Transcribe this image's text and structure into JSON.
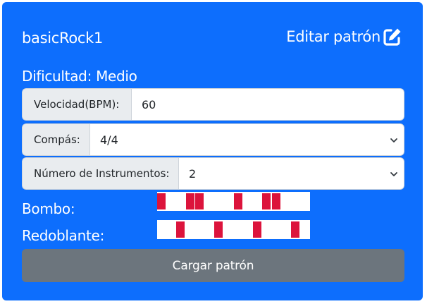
{
  "card": {
    "title": "basicRock1",
    "edit_label": "Editar patrón",
    "edit_icon": "edit-icon",
    "difficulty": "Dificultad: Medio",
    "accent_color": "#0d6efd"
  },
  "fields": {
    "tempo": {
      "label": "Velocidad(BPM):",
      "value": "60"
    },
    "time_signature": {
      "label": "Compás:",
      "value": "4/4",
      "icon": "chevron-down-icon"
    },
    "instruments": {
      "label": "Número de Instrumentos:",
      "value": "2",
      "icon": "chevron-down-icon"
    }
  },
  "instruments": [
    {
      "name": "Bombo:",
      "hit_color": "#dc143c",
      "steps": 16,
      "hits": [
        0,
        3,
        4,
        8,
        11,
        12
      ]
    },
    {
      "name": "Redoblante:",
      "hit_color": "#dc143c",
      "steps": 16,
      "hits": [
        2,
        6,
        10,
        14
      ]
    }
  ],
  "actions": {
    "load_label": "Cargar patrón",
    "load_color": "#6c757d"
  }
}
